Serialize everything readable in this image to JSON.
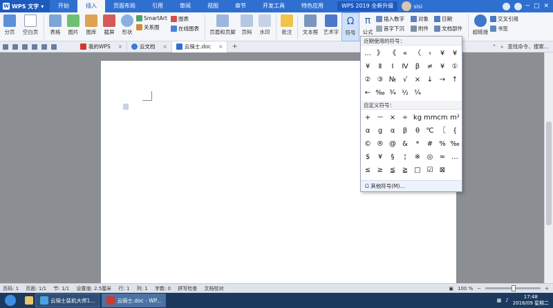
{
  "menubar": {
    "app_label": "WPS 文字",
    "tabs": [
      "开始",
      "插入",
      "页面布局",
      "引用",
      "审阅",
      "视图",
      "章节",
      "开发工具",
      "特色应用"
    ],
    "active_tab": "插入",
    "upgrade": "WPS 2019 全新升级",
    "user": "sisi"
  },
  "ribbon": {
    "page_break": "分页",
    "blank_page": "空白页",
    "table": "表格",
    "picture": "图片",
    "gallery": "图库",
    "screenshot": "截屏",
    "shapes": "形状",
    "smartart": "SmartArt",
    "chart": "图表",
    "relation": "关系图",
    "online_chart": "在线图表",
    "header_footer": "页眉和页脚",
    "page_number": "页码",
    "watermark": "水印",
    "comment": "批注",
    "textbox": "文本框",
    "wordart": "艺术字",
    "symbol": "符号",
    "formula": "公式",
    "insert_number": "插入数字",
    "first_drop": "首字下沉",
    "object": "对象",
    "attachment": "附件",
    "date": "日期",
    "doc_parts": "文档部件",
    "hyperlink": "超链接",
    "crossref": "交叉引用",
    "bookmark": "书签"
  },
  "tabs": {
    "items": [
      "我的WPS",
      "云文档",
      "云骑士.doc"
    ],
    "search": "查找命令、搜索..."
  },
  "symbols": {
    "recent_header": "近期使用的符号：",
    "recent": [
      "…",
      "》",
      "《",
      "«",
      "〈",
      "‹",
      "¥",
      "¥",
      "¥",
      "Ⅱ",
      "Ⅰ",
      "Ⅳ",
      "β",
      "≠",
      "¥",
      "①",
      "②",
      "③",
      "№",
      "√",
      "×",
      "↓",
      "→",
      "↑",
      "←",
      "‰",
      "¾",
      "½",
      "¼"
    ],
    "custom_header": "自定义符号：",
    "custom": [
      "+",
      "－",
      "×",
      "÷",
      "kg",
      "mm",
      "cm",
      "m²",
      "α",
      "g",
      "α",
      "β",
      "θ",
      "℃",
      "〖",
      "{",
      "©",
      "®",
      "@",
      "&",
      "*",
      "#",
      "%",
      "‰",
      "$",
      "¥",
      "§",
      "¦",
      "※",
      "◎",
      "≈",
      "…",
      "≤",
      "≥",
      "≦",
      "≧",
      "□",
      "☑",
      "⊠"
    ],
    "more": "其他符号(M)..."
  },
  "status": {
    "page": "页码: 1",
    "pages": "页面: 1/1",
    "section": "节: 1/1",
    "setting": "设置值: 2.5厘米",
    "row": "行: 1",
    "col": "列: 1",
    "words": "字数: 0",
    "spell": "拼写检查",
    "proof": "文档校对",
    "zoom": "100 %"
  },
  "taskbar": {
    "items": [
      "云骑士装机大师1...",
      "云骑士.doc - WP..."
    ],
    "time": "17:48",
    "date": "2018/09 星期二"
  },
  "colors": {
    "menubar": "#2f6fd0",
    "ribbon": "#f4f6f9",
    "taskbar": "#1c3a5e"
  }
}
